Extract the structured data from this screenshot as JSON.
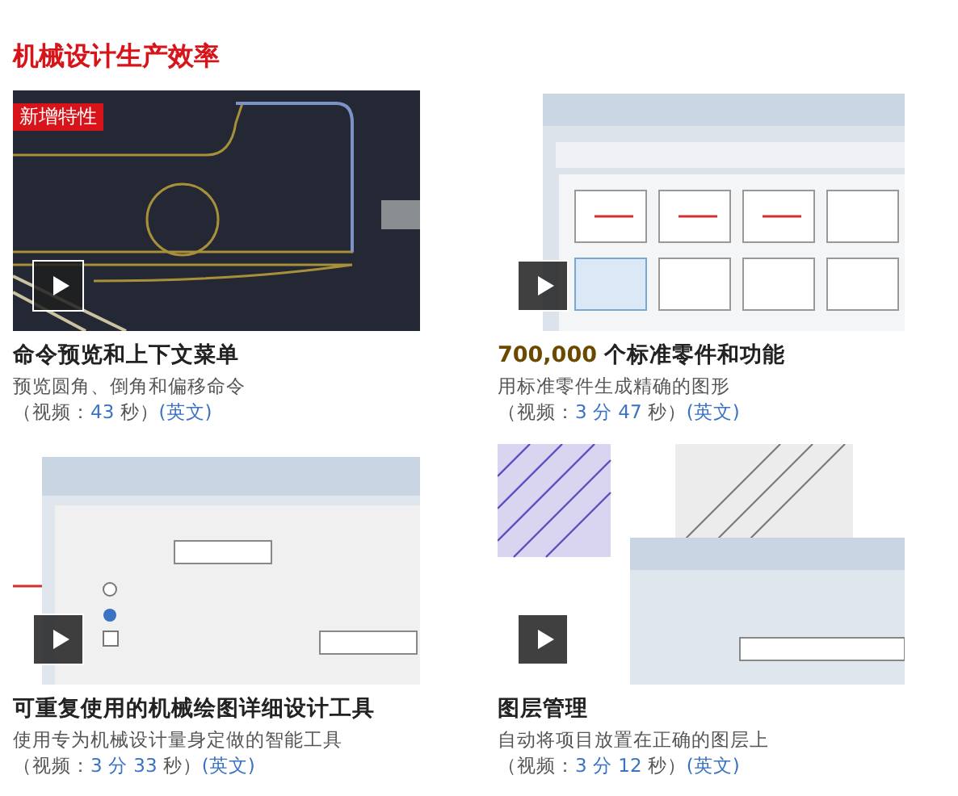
{
  "heading": "机械设计生产效率",
  "videos": [
    {
      "badge": "新增特性",
      "title": "命令预览和上下文菜单",
      "description": "预览圆角、倒角和偏移命令",
      "duration": [
        {
          "kind": "text",
          "text": "（视频："
        },
        {
          "kind": "number",
          "text": "43"
        },
        {
          "kind": "text",
          "text": " 秒）"
        }
      ],
      "language": "(英文)"
    },
    {
      "title_lead": "700,000",
      "title": " 个标准零件和功能",
      "description": "用标准零件生成精确的图形",
      "duration": [
        {
          "kind": "text",
          "text": "（视频："
        },
        {
          "kind": "number",
          "text": "3 分 47"
        },
        {
          "kind": "text",
          "text": " 秒）"
        }
      ],
      "language": "(英文)"
    },
    {
      "title": "可重复使用的机械绘图详细设计工具",
      "description": "使用专为机械设计量身定做的智能工具",
      "duration": [
        {
          "kind": "text",
          "text": "（视频："
        },
        {
          "kind": "number",
          "text": "3 分 33"
        },
        {
          "kind": "text",
          "text": " 秒）"
        }
      ],
      "language": "(英文)"
    },
    {
      "title": "图层管理",
      "description": "自动将项目放置在正确的图层上",
      "duration": [
        {
          "kind": "text",
          "text": "（视频："
        },
        {
          "kind": "number",
          "text": "3 分 12"
        },
        {
          "kind": "text",
          "text": " 秒）"
        }
      ],
      "language": "(英文)"
    }
  ]
}
